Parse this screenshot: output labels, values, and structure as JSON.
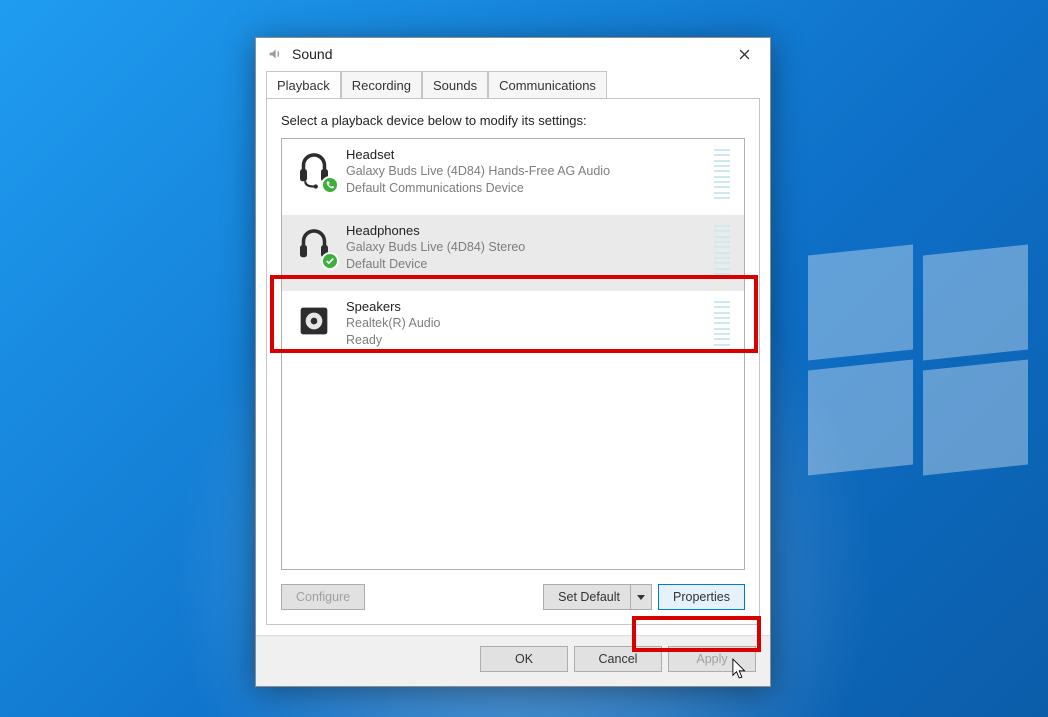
{
  "window": {
    "title": "Sound"
  },
  "tabs": {
    "playback": "Playback",
    "recording": "Recording",
    "sounds": "Sounds",
    "communications": "Communications",
    "active": "playback"
  },
  "instruction": "Select a playback device below to modify its settings:",
  "devices": [
    {
      "icon": "headset-icon",
      "badge": "phone",
      "name": "Headset",
      "sub1": "Galaxy Buds Live (4D84) Hands-Free AG Audio",
      "sub2": "Default Communications Device",
      "selected": false
    },
    {
      "icon": "headphones-icon",
      "badge": "check",
      "name": "Headphones",
      "sub1": "Galaxy Buds Live (4D84) Stereo",
      "sub2": "Default Device",
      "selected": true
    },
    {
      "icon": "speaker-icon",
      "badge": "",
      "name": "Speakers",
      "sub1": "Realtek(R) Audio",
      "sub2": "Ready",
      "selected": false
    }
  ],
  "buttons": {
    "configure": "Configure",
    "setdefault": "Set Default",
    "properties": "Properties",
    "ok": "OK",
    "cancel": "Cancel",
    "apply": "Apply"
  }
}
